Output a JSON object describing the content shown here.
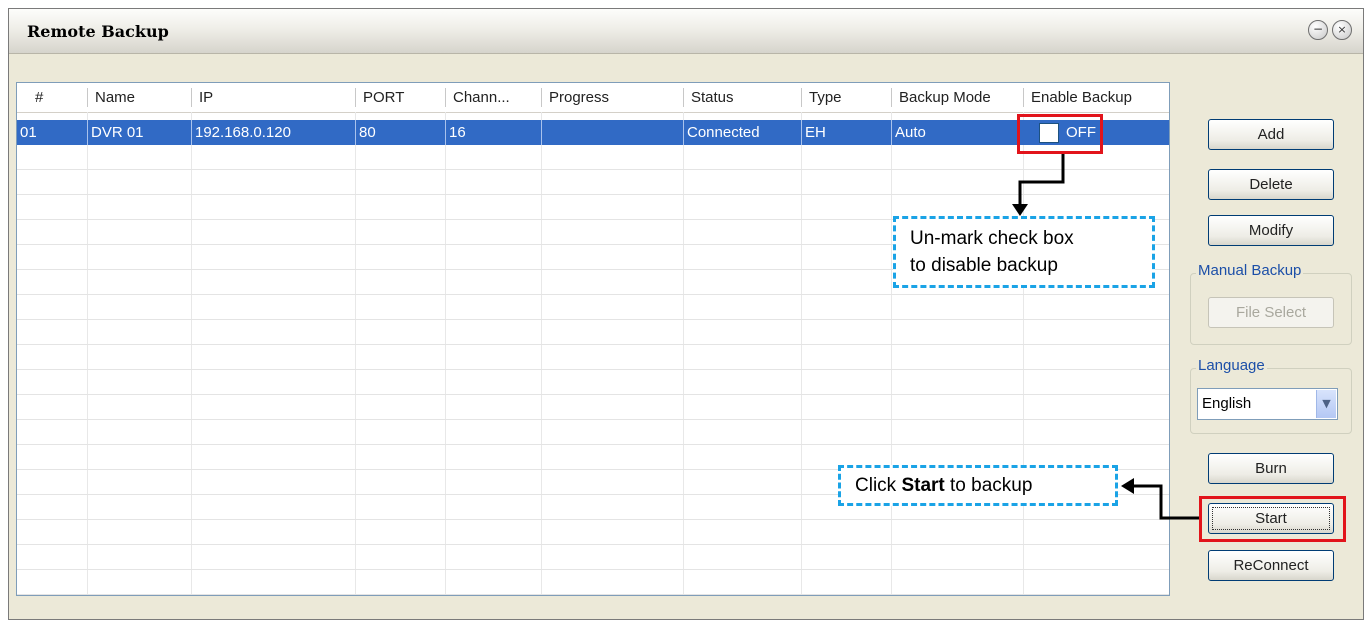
{
  "window": {
    "title": "Remote Backup",
    "minimize_glyph": "−",
    "close_glyph": "×"
  },
  "table": {
    "headers": [
      "#",
      "Name",
      "IP",
      "PORT",
      "Chann...",
      "Progress",
      "Status",
      "Type",
      "Backup Mode",
      "Enable Backup"
    ],
    "rows": [
      {
        "num": "01",
        "name": "DVR 01",
        "ip": "192.168.0.120",
        "port": "80",
        "channels": "16",
        "progress": "",
        "status": "Connected",
        "type": "EH",
        "mode": "Auto",
        "enable_backup_checked": false,
        "enable_backup_text": "OFF"
      }
    ]
  },
  "buttons": {
    "add": "Add",
    "delete": "Delete",
    "modify": "Modify",
    "file_select": "File Select",
    "burn": "Burn",
    "start": "Start",
    "reconnect": "ReConnect"
  },
  "groups": {
    "manual_backup": "Manual Backup",
    "language": "Language"
  },
  "language_select": {
    "value": "English"
  },
  "annotations": {
    "uncheck_line1": "Un-mark check box",
    "uncheck_line2": "to disable backup",
    "start_pre": "Click ",
    "start_bold": "Start",
    "start_post": " to backup"
  },
  "colors": {
    "selection": "#316ac5",
    "highlight_red": "#e2141b",
    "callout_blue": "#1aa3e6"
  }
}
